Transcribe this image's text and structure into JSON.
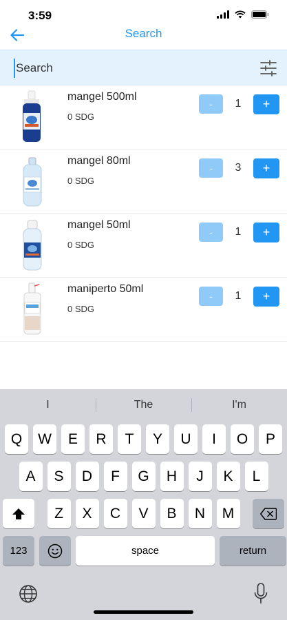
{
  "status": {
    "time": "3:59"
  },
  "nav": {
    "title": "Search"
  },
  "search": {
    "placeholder": "Search",
    "value": ""
  },
  "products": [
    {
      "name": "mangel 500ml",
      "price": "0 SDG",
      "qty": "1",
      "minus": "-",
      "plus": "+"
    },
    {
      "name": "mangel 80ml",
      "price": "0 SDG",
      "qty": "3",
      "minus": "-",
      "plus": "+"
    },
    {
      "name": "mangel 50ml",
      "price": "0 SDG",
      "qty": "1",
      "minus": "-",
      "plus": "+"
    },
    {
      "name": "maniperto 50ml",
      "price": "0 SDG",
      "qty": "1",
      "minus": "-",
      "plus": "+"
    }
  ],
  "keyboard": {
    "suggestions": [
      "I",
      "The",
      "I'm"
    ],
    "row1": [
      "Q",
      "W",
      "E",
      "R",
      "T",
      "Y",
      "U",
      "I",
      "O",
      "P"
    ],
    "row2": [
      "A",
      "S",
      "D",
      "F",
      "G",
      "H",
      "J",
      "K",
      "L"
    ],
    "row3": [
      "Z",
      "X",
      "C",
      "V",
      "B",
      "N",
      "M"
    ],
    "numbers_label": "123",
    "space_label": "space",
    "return_label": "return"
  },
  "colors": {
    "accent": "#2196f3",
    "accent_light": "#90caf9",
    "search_bg": "#e3f2fd",
    "keyboard_bg": "#d3d5db"
  },
  "icons": [
    "back-arrow-icon",
    "filter-sliders-icon",
    "shift-icon",
    "backspace-icon",
    "emoji-icon",
    "globe-icon",
    "mic-icon",
    "signal-icon",
    "wifi-icon",
    "battery-icon"
  ]
}
